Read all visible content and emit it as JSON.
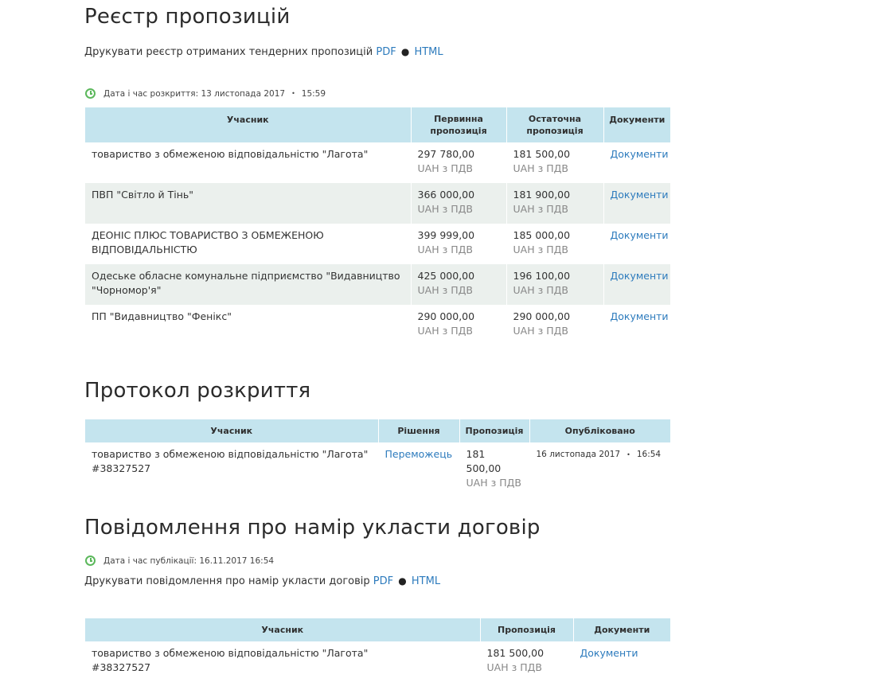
{
  "registry": {
    "title": "Реєстр пропозицій",
    "print_text": "Друкувати реєстр отриманих тендерних пропозицій",
    "pdf": "PDF",
    "bullet": "●",
    "html": "HTML",
    "opening_label": "Дата і час розкриття: 13 листопада 2017",
    "opening_sep": "•",
    "opening_time": "15:59",
    "headers": {
      "participant": "Учасник",
      "initial": "Первинна пропозиція",
      "final": "Остаточна пропозиція",
      "docs": "Документи"
    },
    "rows": [
      {
        "name": "товариство з обмеженою відповідальністю \"Лагота\"",
        "initial": "297 780,00",
        "initial_cur": "UAH з ПДВ",
        "final": "181 500,00",
        "final_cur": "UAH з ПДВ",
        "docs": "Документи"
      },
      {
        "name": "ПВП \"Світло й Тінь\"",
        "initial": "366 000,00",
        "initial_cur": "UAH з ПДВ",
        "final": "181 900,00",
        "final_cur": "UAH з ПДВ",
        "docs": "Документи"
      },
      {
        "name": "ДЕОНІС ПЛЮС ТОВАРИСТВО З ОБМЕЖЕНОЮ ВІДПОВІДАЛЬНІСТЮ",
        "initial": "399 999,00",
        "initial_cur": "UAH з ПДВ",
        "final": "185 000,00",
        "final_cur": "UAH з ПДВ",
        "docs": "Документи"
      },
      {
        "name": "Одеське обласне комунальне підприємство \"Видавництво \"Чорномор'я\"",
        "initial": "425 000,00",
        "initial_cur": "UAH з ПДВ",
        "final": "196 100,00",
        "final_cur": "UAH з ПДВ",
        "docs": "Документи"
      },
      {
        "name": "ПП \"Видавництво \"Фенікс\"",
        "initial": "290 000,00",
        "initial_cur": "UAH з ПДВ",
        "final": "290 000,00",
        "final_cur": "UAH з ПДВ",
        "docs": "Документи"
      }
    ]
  },
  "protocol": {
    "title": "Протокол розкриття",
    "headers": {
      "participant": "Учасник",
      "decision": "Рішення",
      "offer": "Пропозиція",
      "published": "Опубліковано"
    },
    "rows": [
      {
        "name": "товариство з обмеженою відповідальністю \"Лагота\"",
        "code": "#38327527",
        "decision": "Переможець",
        "offer": "181 500,00",
        "offer_cur": "UAH з ПДВ",
        "date": "16 листопада 2017",
        "sep": "•",
        "time": "16:54"
      }
    ]
  },
  "notice": {
    "title": "Повідомлення про намір укласти договір",
    "pub_label": "Дата і час публікації: 16.11.2017 16:54",
    "print_text": "Друкувати повідомлення про намір укласти договір",
    "pdf": "PDF",
    "bullet": "●",
    "html": "HTML",
    "headers": {
      "participant": "Учасник",
      "offer": "Пропозиція",
      "docs": "Документи"
    },
    "rows": [
      {
        "name": "товариство з обмеженою відповідальністю \"Лагота\"",
        "code": "#38327527",
        "offer": "181 500,00",
        "offer_cur": "UAH з ПДВ",
        "docs": "Документи"
      }
    ]
  },
  "colors": {
    "header_bg": "#c4e4ee",
    "alt_row": "#ebf0ed",
    "link": "#2d7bbd",
    "clock": "#5cb85c"
  }
}
